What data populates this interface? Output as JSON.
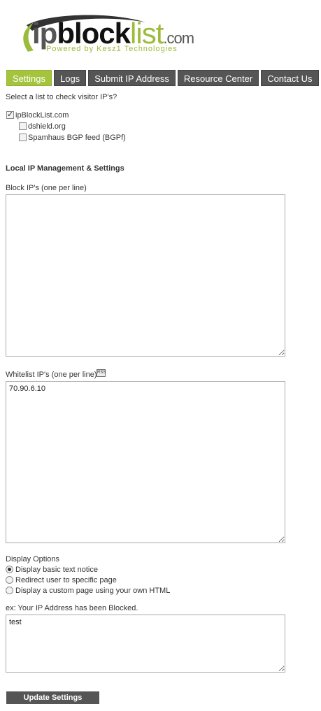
{
  "logo": {
    "ip": "ip",
    "block": "block",
    "list": "list",
    "com": ".com",
    "tagline": "Powered by Kesz1 Technologies"
  },
  "tabs": [
    {
      "label": "Settings",
      "active": true
    },
    {
      "label": "Logs",
      "active": false
    },
    {
      "label": "Submit IP Address",
      "active": false
    },
    {
      "label": "Resource Center",
      "active": false
    },
    {
      "label": "Contact Us",
      "active": false
    }
  ],
  "lists": {
    "prompt": "Select a list to check visitor IP's?",
    "items": [
      {
        "label": "ipBlockList.com",
        "checked": true
      },
      {
        "label": "dshield.org",
        "checked": false
      },
      {
        "label": "Spamhaus BGP feed (BGPf)",
        "checked": false
      }
    ]
  },
  "local": {
    "heading": "Local IP Management & Settings",
    "block_label": "Block IP's (one per line)",
    "block_value": "",
    "whitelist_label": "Whitelist IP's (one per line)",
    "whitelist_value": "70.90.6.10"
  },
  "display": {
    "heading": "Display Options",
    "options": [
      {
        "label": "Display basic text notice",
        "checked": true
      },
      {
        "label": "Redirect user to specific page",
        "checked": false
      },
      {
        "label": "Display a custom page using your own HTML",
        "checked": false
      }
    ],
    "example_label": "ex: Your IP Address has been Blocked.",
    "notice_value": "test"
  },
  "submit": {
    "label": "Update Settings"
  },
  "colors": {
    "accent": "#a5c43d",
    "tab_bg": "#555555"
  }
}
